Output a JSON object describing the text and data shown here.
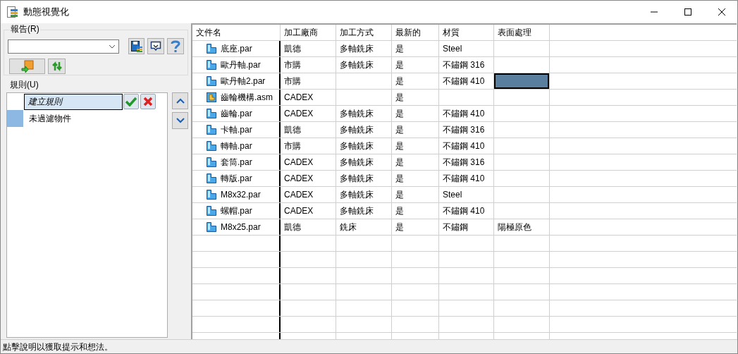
{
  "window": {
    "title": "動態視覺化"
  },
  "report": {
    "label": "報告(R)"
  },
  "rules": {
    "label": "規則(U)",
    "items": [
      {
        "kind": "editing",
        "label": "建立規則"
      },
      {
        "kind": "rule",
        "label": "未過濾物件",
        "color": "#8db8e3"
      }
    ]
  },
  "table": {
    "columns": [
      "文件名",
      "加工廠商",
      "加工方式",
      "最新的",
      "材質",
      "表面處理"
    ],
    "rows": [
      {
        "kind": "part",
        "cells": [
          "底座.par",
          "凱德",
          "多軸銑床",
          "是",
          "Steel",
          ""
        ]
      },
      {
        "kind": "part",
        "cells": [
          "歐丹軸.par",
          "市購",
          "多軸銑床",
          "是",
          "不鏽鋼 316",
          ""
        ]
      },
      {
        "kind": "part",
        "cells": [
          "歐丹軸2.par",
          "市購",
          "",
          "是",
          "不鏽鋼 410",
          ""
        ],
        "color": "#5a7f9e"
      },
      {
        "kind": "assembly",
        "cells": [
          "齒輪機構.asm",
          "CADEX",
          "",
          "是",
          "",
          ""
        ]
      },
      {
        "kind": "part",
        "cells": [
          "齒輪.par",
          "CADEX",
          "多軸銑床",
          "是",
          "不鏽鋼 410",
          ""
        ]
      },
      {
        "kind": "part",
        "cells": [
          "卡軸.par",
          "凱德",
          "多軸銑床",
          "是",
          "不鏽鋼 316",
          ""
        ]
      },
      {
        "kind": "part",
        "cells": [
          "轉軸.par",
          "市購",
          "多軸銑床",
          "是",
          "不鏽鋼 410",
          ""
        ]
      },
      {
        "kind": "part",
        "cells": [
          "套筒.par",
          "CADEX",
          "多軸銑床",
          "是",
          "不鏽鋼 316",
          ""
        ]
      },
      {
        "kind": "part",
        "cells": [
          "轉版.par",
          "CADEX",
          "多軸銑床",
          "是",
          "不鏽鋼 410",
          ""
        ]
      },
      {
        "kind": "part",
        "cells": [
          "M8x32.par",
          "CADEX",
          "多軸銑床",
          "是",
          "Steel",
          ""
        ]
      },
      {
        "kind": "part",
        "cells": [
          "螺帽.par",
          "CADEX",
          "多軸銑床",
          "是",
          "不鏽鋼 410",
          ""
        ]
      },
      {
        "kind": "part",
        "cells": [
          "M8x25.par",
          "凱德",
          "銑床",
          "是",
          "不鏽鋼",
          "陽極原色"
        ]
      }
    ]
  },
  "status_bar": "點擊說明以獲取提示和想法。"
}
